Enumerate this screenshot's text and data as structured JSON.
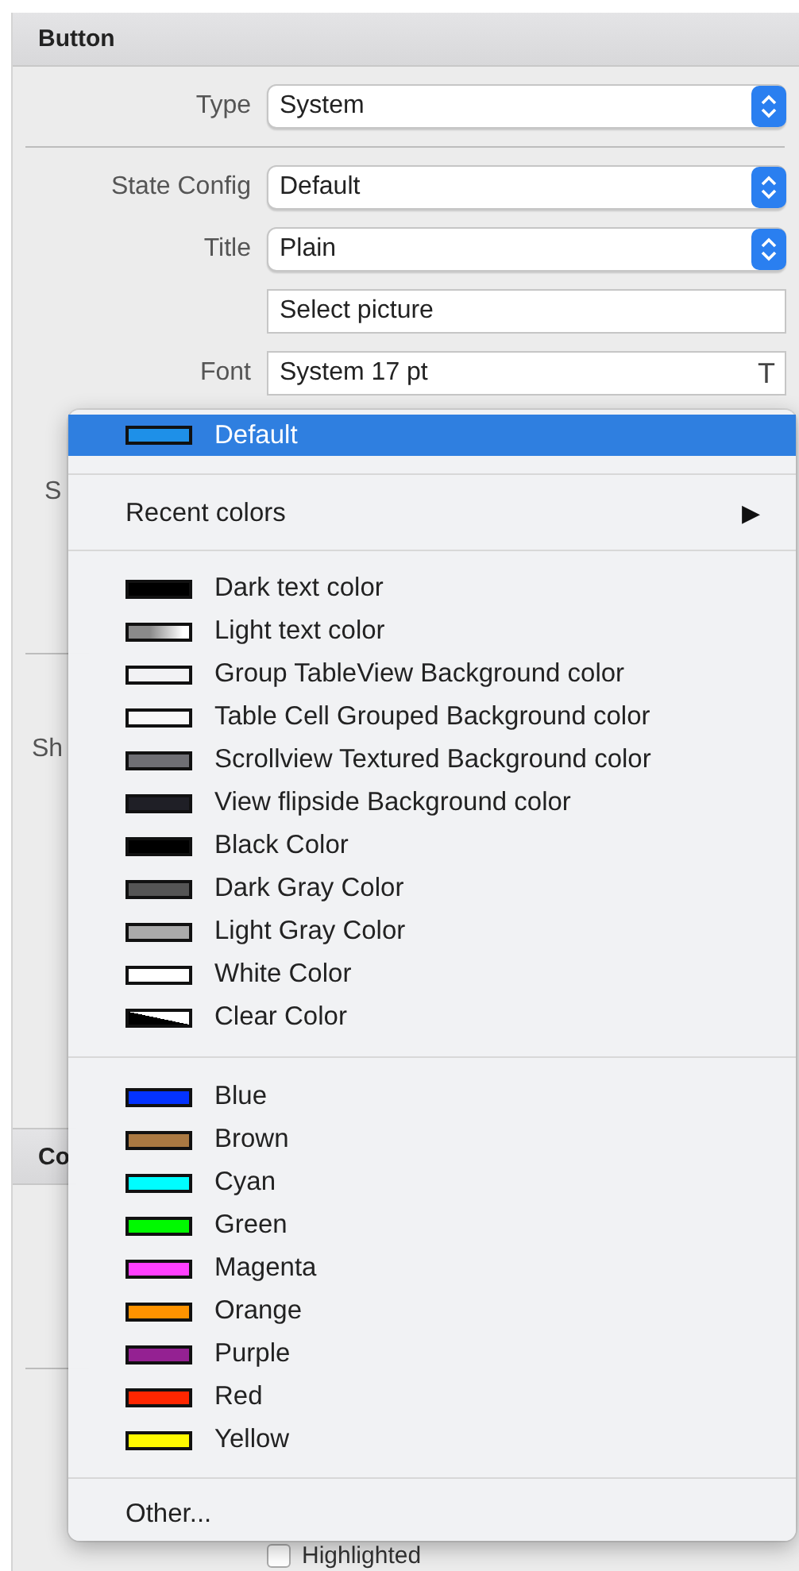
{
  "panel": {
    "header": "Button",
    "groups": [
      [
        {
          "kind": "popup",
          "label": "Type",
          "value": "System"
        }
      ],
      [
        {
          "kind": "popup",
          "label": "State Config",
          "value": "Default"
        },
        {
          "kind": "popup",
          "label": "Title",
          "value": "Plain"
        },
        {
          "kind": "text",
          "value": "Select picture"
        },
        {
          "kind": "font",
          "label": "Font",
          "value": "System 17 pt",
          "button": "T"
        }
      ]
    ],
    "covered_labels": [
      "S",
      "Sh"
    ],
    "section_2": {
      "header": "Co"
    },
    "checkbox": {
      "label": "Highlighted",
      "checked": false
    }
  },
  "color_menu": {
    "default": {
      "label": "Default",
      "color": "#1e90e8",
      "selected": true
    },
    "recent": {
      "label": "Recent colors",
      "arrow": "▶"
    },
    "system_colors": [
      {
        "label": "Dark text color",
        "kind": "solid",
        "color": "#000000"
      },
      {
        "label": "Light text color",
        "kind": "gradient",
        "color": "#8a8a8a"
      },
      {
        "label": "Group TableView Background color",
        "kind": "solid",
        "color": "#f2f2f4"
      },
      {
        "label": "Table Cell Grouped Background color",
        "kind": "solid",
        "color": "#f8f8f8"
      },
      {
        "label": "Scrollview Textured Background color",
        "kind": "solid",
        "color": "#6f6f74"
      },
      {
        "label": "View flipside Background color",
        "kind": "solid",
        "color": "#1f1f26"
      },
      {
        "label": "Black Color",
        "kind": "solid",
        "color": "#000000"
      },
      {
        "label": "Dark Gray Color",
        "kind": "solid",
        "color": "#555555"
      },
      {
        "label": "Light Gray Color",
        "kind": "solid",
        "color": "#aaaaaa"
      },
      {
        "label": "White Color",
        "kind": "solid",
        "color": "#ffffff"
      },
      {
        "label": "Clear Color",
        "kind": "clear",
        "color": "#000000"
      }
    ],
    "basic_colors": [
      {
        "label": "Blue",
        "color": "#0433ff"
      },
      {
        "label": "Brown",
        "color": "#aa7942"
      },
      {
        "label": "Cyan",
        "color": "#00fdff"
      },
      {
        "label": "Green",
        "color": "#00f900"
      },
      {
        "label": "Magenta",
        "color": "#ff40ff"
      },
      {
        "label": "Orange",
        "color": "#ff9300"
      },
      {
        "label": "Purple",
        "color": "#942192"
      },
      {
        "label": "Red",
        "color": "#ff2600"
      },
      {
        "label": "Yellow",
        "color": "#fffb00"
      }
    ],
    "other": "Other..."
  }
}
